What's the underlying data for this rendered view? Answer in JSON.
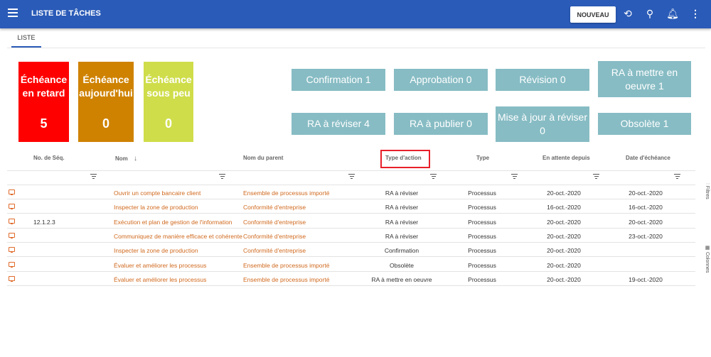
{
  "header": {
    "title": "LISTE DE TÂCHES",
    "new_label": "NOUVEAU"
  },
  "tabs": [
    {
      "label": "LISTE"
    }
  ],
  "cards": [
    {
      "label": "Échéance en retard",
      "count": "5",
      "color": "#ff0000"
    },
    {
      "label": "Échéance aujourd'hui",
      "count": "0",
      "color": "#cf8200"
    },
    {
      "label": "Échéance sous peu",
      "count": "0",
      "color": "#cfdd4a"
    }
  ],
  "actions": [
    "Confirmation 1",
    "Approbation 0",
    "Révision 0",
    "RA à mettre en oeuvre 1",
    "RA à réviser 4",
    "RA à publier 0",
    "Mise à jour à réviser 0",
    "Obsolète 1"
  ],
  "columns": [
    "No. de Séq.",
    "Nom",
    "Nom du parent",
    "Type d'action",
    "Type",
    "En attente depuis",
    "Date d'échéance"
  ],
  "rows": [
    [
      "",
      "Ouvrir un compte bancaire client",
      "Ensemble de processus importé",
      "RA à réviser",
      "Processus",
      "20-oct.-2020",
      "20-oct.-2020"
    ],
    [
      "",
      "Inspecter la zone de production",
      "Conformité d'entreprise",
      "RA à réviser",
      "Processus",
      "16-oct.-2020",
      "16-oct.-2020"
    ],
    [
      "12.1.2.3",
      "Exécution et plan de gestion de l'information",
      "Conformité d'entreprise",
      "RA à réviser",
      "Processus",
      "20-oct.-2020",
      "20-oct.-2020"
    ],
    [
      "",
      "Communiquez de manière efficace et cohérente",
      "Conformité d'entreprise",
      "RA à réviser",
      "Processus",
      "20-oct.-2020",
      "23-oct.-2020"
    ],
    [
      "",
      "Inspecter la zone de production",
      "Conformité d'entreprise",
      "Confirmation",
      "Processus",
      "20-oct.-2020",
      ""
    ],
    [
      "",
      "Évaluer et améliorer les processus",
      "Ensemble de processus importé",
      "Obsolète",
      "Processus",
      "20-oct.-2020",
      ""
    ],
    [
      "",
      "Évaluer et améliorer les processus",
      "Ensemble de processus importé",
      "RA à mettre en oeuvre",
      "Processus",
      "20-oct.-2020",
      "19-oct.-2020"
    ]
  ],
  "side": {
    "filters": "Filtres",
    "columns": "Colonnes"
  }
}
